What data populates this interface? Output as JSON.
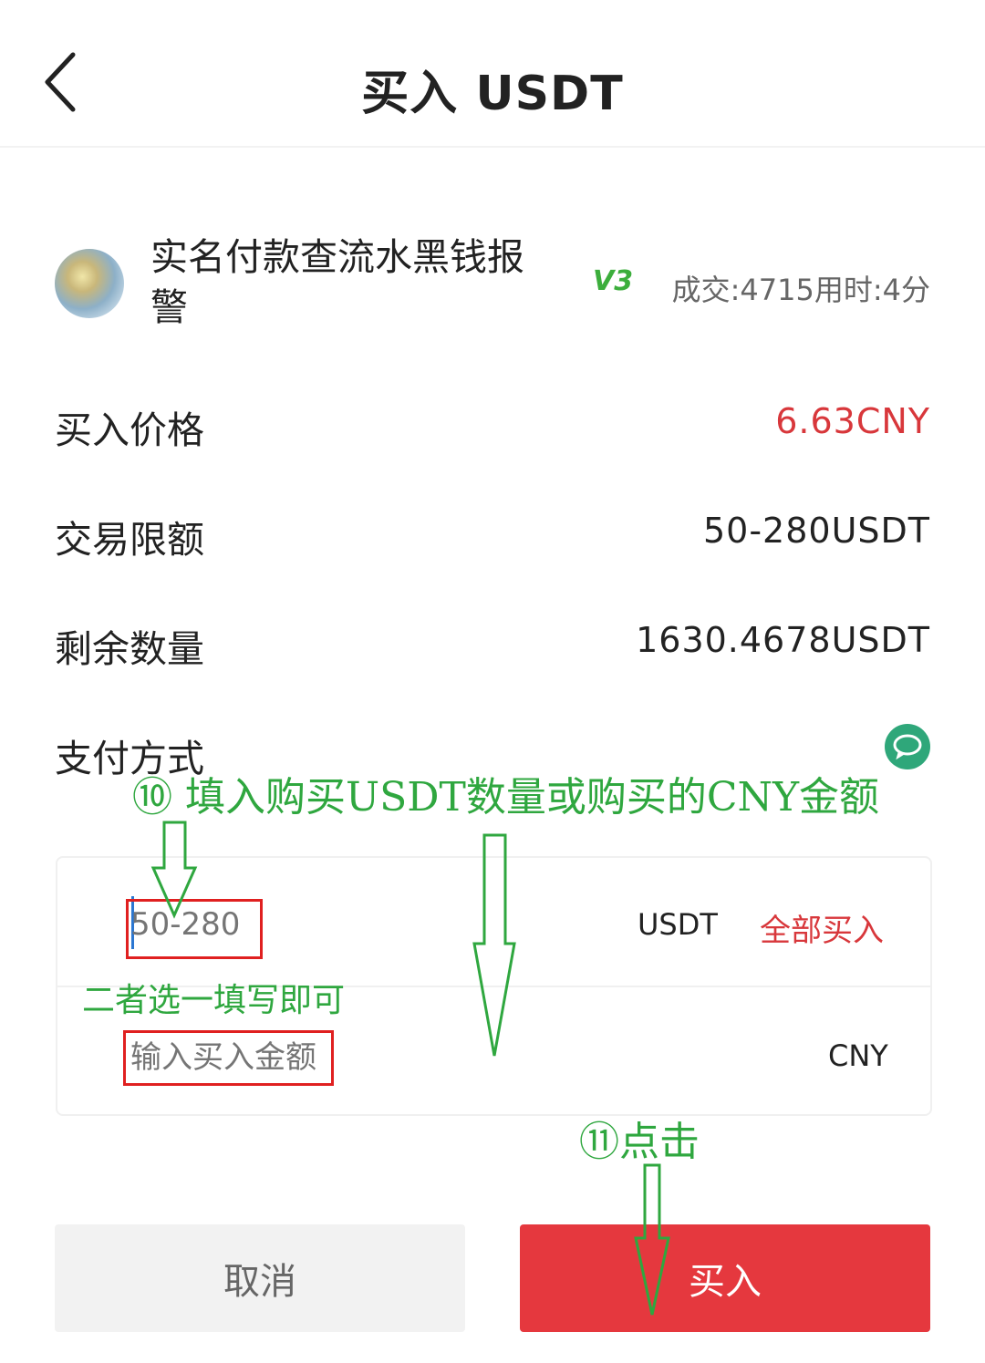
{
  "header": {
    "title": "买入 USDT"
  },
  "merchant": {
    "name": "实名付款查流水黑钱报警",
    "level": "V3",
    "stats": "成交:4715用时:4分"
  },
  "info": {
    "price_label": "买入价格",
    "price_value": "6.63CNY",
    "limit_label": "交易限额",
    "limit_value": "50-280USDT",
    "remaining_label": "剩余数量",
    "remaining_value": "1630.4678USDT",
    "payment_label": "支付方式"
  },
  "input": {
    "amount_placeholder": "50-280",
    "amount_unit": "USDT",
    "buy_all": "全部买入",
    "cny_placeholder": "输入买入金额",
    "cny_unit": "CNY"
  },
  "buttons": {
    "cancel": "取消",
    "buy": "买入"
  },
  "annotations": {
    "step10": "⑩ 填入购买USDT数量或购买的CNY金额",
    "either": "二者选一填写即可",
    "step11": "⑪点击"
  },
  "colors": {
    "accent_red": "#e5383e",
    "price_red": "#d8373b",
    "annotation_green": "#2fa73f",
    "level_green": "#3cae3c"
  }
}
